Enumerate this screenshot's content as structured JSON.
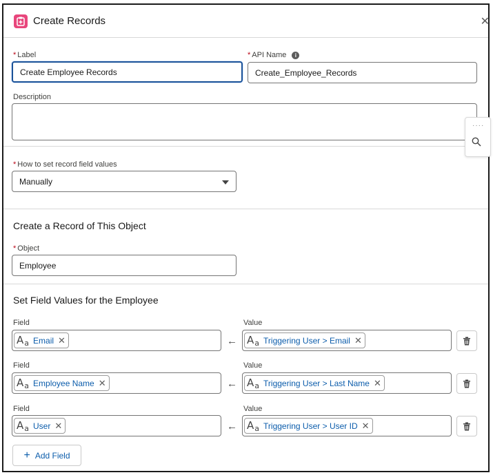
{
  "header": {
    "title": "Create Records",
    "icon": "clipboard-icon",
    "icon_color": "#e8467c"
  },
  "form": {
    "label": {
      "required": "*",
      "text": "Label",
      "value": "Create Employee Records"
    },
    "api_name": {
      "required": "*",
      "text": "API Name",
      "value": "Create_Employee_Records"
    },
    "description": {
      "text": "Description",
      "value": ""
    },
    "how_to_set": {
      "required": "*",
      "text": "How to set record field values",
      "value": "Manually"
    }
  },
  "object_section": {
    "title": "Create a Record of This Object",
    "object": {
      "required": "*",
      "text": "Object",
      "value": "Employee"
    }
  },
  "field_values": {
    "title": "Set Field Values for the Employee",
    "field_label": "Field",
    "value_label": "Value",
    "rows": [
      {
        "field": "Email",
        "value": "Triggering User > Email"
      },
      {
        "field": "Employee Name",
        "value": "Triggering User > Last Name"
      },
      {
        "field": "User",
        "value": "Triggering User > User ID"
      }
    ]
  },
  "add_field": {
    "label": "Add Field"
  },
  "colors": {
    "accent": "#0b5cab",
    "required": "#ba0517",
    "focus_border": "#1b5297"
  }
}
